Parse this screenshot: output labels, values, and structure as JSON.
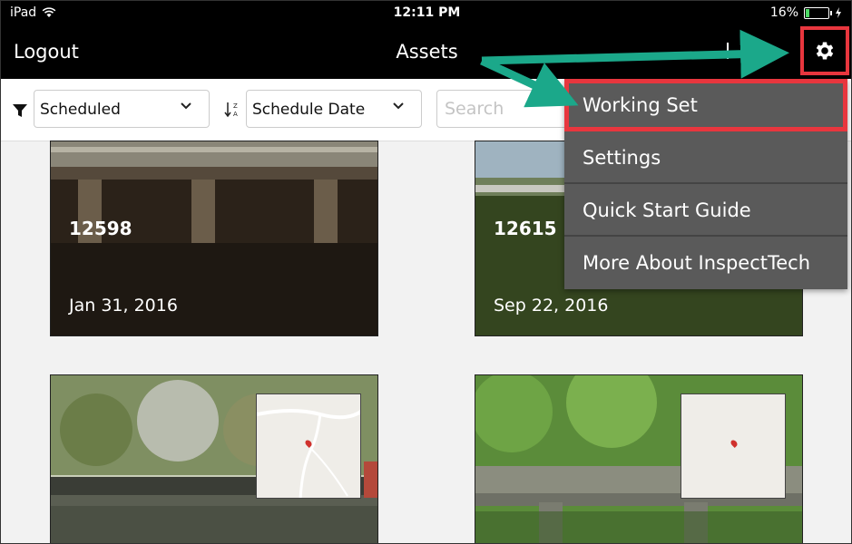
{
  "status": {
    "device": "iPad",
    "time": "12:11 PM",
    "battery": "16%",
    "battery_level": 0.16
  },
  "nav": {
    "logout_label": "Logout",
    "title": "Assets"
  },
  "filters": {
    "status_select": "Scheduled",
    "sort_select": "Schedule Date",
    "search_placeholder": "Search"
  },
  "cards": [
    {
      "id": "12598",
      "date": "Jan 31, 2016"
    },
    {
      "id": "12615",
      "date": "Sep 22, 2016"
    }
  ],
  "menu": {
    "items": [
      {
        "label": "Working Set"
      },
      {
        "label": "Settings"
      },
      {
        "label": "Quick Start Guide"
      },
      {
        "label": "More About InspectTech"
      }
    ]
  },
  "colors": {
    "highlight": "#e8363e",
    "arrow": "#1ba88a",
    "menu_bg": "#5a5a5a"
  }
}
